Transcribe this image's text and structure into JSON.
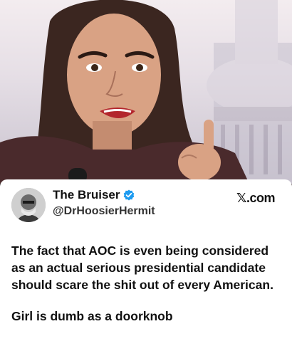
{
  "post": {
    "author_name": "The Bruiser",
    "author_handle": "@DrHoosierHermit",
    "site_label": "𝕏.com",
    "body_paragraphs": [
      "The fact that AOC is even being considered as an actual serious presidential candidate should scare the shit out of every American.",
      "Girl is dumb as a doorknob"
    ]
  },
  "icons": {
    "verified": "verified-badge-icon",
    "avatar": "avatar-image"
  },
  "colors": {
    "verified_blue": "#1d9bf0",
    "card_bg": "#ffffff",
    "text": "#111111"
  }
}
